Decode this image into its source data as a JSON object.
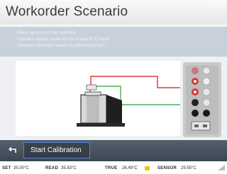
{
  "header": {
    "title": "Workorder Scenario",
    "clock": "14:2",
    "clock_icon": "power-icon"
  },
  "instructions": [
    "Place sensors in the calibrator",
    "Connect sensor under test to 4-wire RTD input",
    "Connect reference sensor to reference input"
  ],
  "diagram": {
    "wire_colors": {
      "red": "#d83a3a",
      "green": "#4caf50"
    },
    "device_icon": "dry-block-calibrator-icon",
    "terminals": [
      "red",
      "white",
      "red",
      "white",
      "black",
      "black",
      "dark"
    ]
  },
  "toolbar": {
    "back_icon": "back-arrow-icon",
    "start_label": "Start Calibration"
  },
  "status": {
    "set_label": "SET",
    "set_value": "35.00°C",
    "read_label": "READ",
    "read_value": "35.83°C",
    "true_label": "TRUE",
    "true_value": "26.49°C",
    "sensor_label": "SENSOR",
    "sensor_value": "29.55°C",
    "true_indicator_color": "#f2c400"
  }
}
